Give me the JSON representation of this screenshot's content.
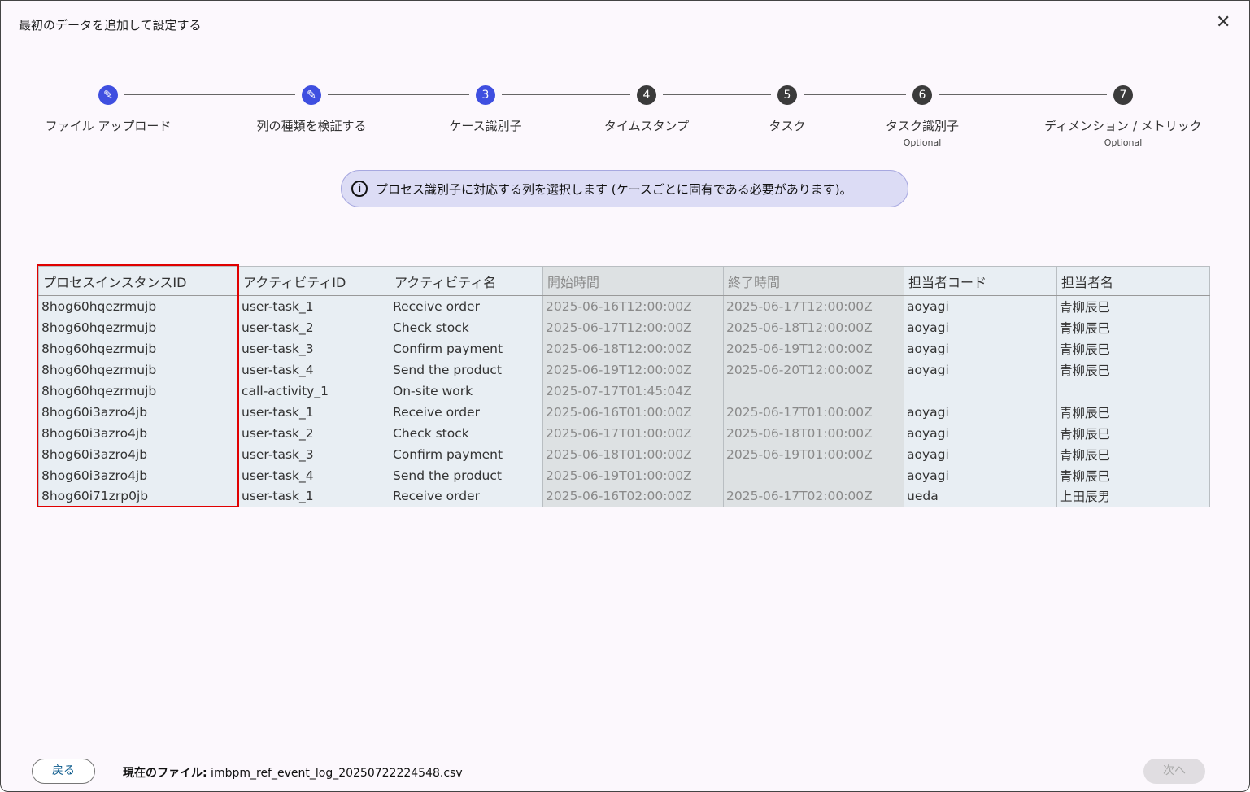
{
  "dialog": {
    "title": "最初のデータを追加して設定する"
  },
  "steps": [
    {
      "label": "ファイル アップロード",
      "state": "done"
    },
    {
      "label": "列の種類を検証する",
      "state": "done"
    },
    {
      "label": "ケース識別子",
      "number": "3",
      "state": "current"
    },
    {
      "label": "タイムスタンプ",
      "number": "4",
      "state": "todo"
    },
    {
      "label": "タスク",
      "number": "5",
      "state": "todo"
    },
    {
      "label": "タスク識別子",
      "number": "6",
      "state": "todo",
      "optional": "Optional"
    },
    {
      "label": "ディメンション / メトリック",
      "number": "7",
      "state": "todo",
      "optional": "Optional"
    }
  ],
  "info": "プロセス識別子に対応する列を選択します (ケースごとに固有である必要があります)。",
  "table": {
    "headers": [
      "プロセスインスタンスID",
      "アクティビティID",
      "アクティビティ名",
      "開始時間",
      "終了時間",
      "担当者コード",
      "担当者名"
    ],
    "rows": [
      [
        "8hog60hqezrmujb",
        "user-task_1",
        "Receive order",
        "2025-06-16T12:00:00Z",
        "2025-06-17T12:00:00Z",
        "aoyagi",
        "青柳辰巳"
      ],
      [
        "8hog60hqezrmujb",
        "user-task_2",
        "Check stock",
        "2025-06-17T12:00:00Z",
        "2025-06-18T12:00:00Z",
        "aoyagi",
        "青柳辰巳"
      ],
      [
        "8hog60hqezrmujb",
        "user-task_3",
        "Confirm payment",
        "2025-06-18T12:00:00Z",
        "2025-06-19T12:00:00Z",
        "aoyagi",
        "青柳辰巳"
      ],
      [
        "8hog60hqezrmujb",
        "user-task_4",
        "Send the product",
        "2025-06-19T12:00:00Z",
        "2025-06-20T12:00:00Z",
        "aoyagi",
        "青柳辰巳"
      ],
      [
        "8hog60hqezrmujb",
        "call-activity_1",
        "On-site work",
        "2025-07-17T01:45:04Z",
        "",
        "",
        ""
      ],
      [
        "8hog60i3azro4jb",
        "user-task_1",
        "Receive order",
        "2025-06-16T01:00:00Z",
        "2025-06-17T01:00:00Z",
        "aoyagi",
        "青柳辰巳"
      ],
      [
        "8hog60i3azro4jb",
        "user-task_2",
        "Check stock",
        "2025-06-17T01:00:00Z",
        "2025-06-18T01:00:00Z",
        "aoyagi",
        "青柳辰巳"
      ],
      [
        "8hog60i3azro4jb",
        "user-task_3",
        "Confirm payment",
        "2025-06-18T01:00:00Z",
        "2025-06-19T01:00:00Z",
        "aoyagi",
        "青柳辰巳"
      ],
      [
        "8hog60i3azro4jb",
        "user-task_4",
        "Send the product",
        "2025-06-19T01:00:00Z",
        "",
        "aoyagi",
        "青柳辰巳"
      ],
      [
        "8hog60i71zrp0jb",
        "user-task_1",
        "Receive order",
        "2025-06-16T02:00:00Z",
        "2025-06-17T02:00:00Z",
        "ueda",
        "上田辰男"
      ]
    ]
  },
  "footer": {
    "back": "戻る",
    "file_label": "現在のファイル:",
    "file_name": " imbpm_ref_event_log_20250722224548.csv",
    "next": "次へ"
  }
}
